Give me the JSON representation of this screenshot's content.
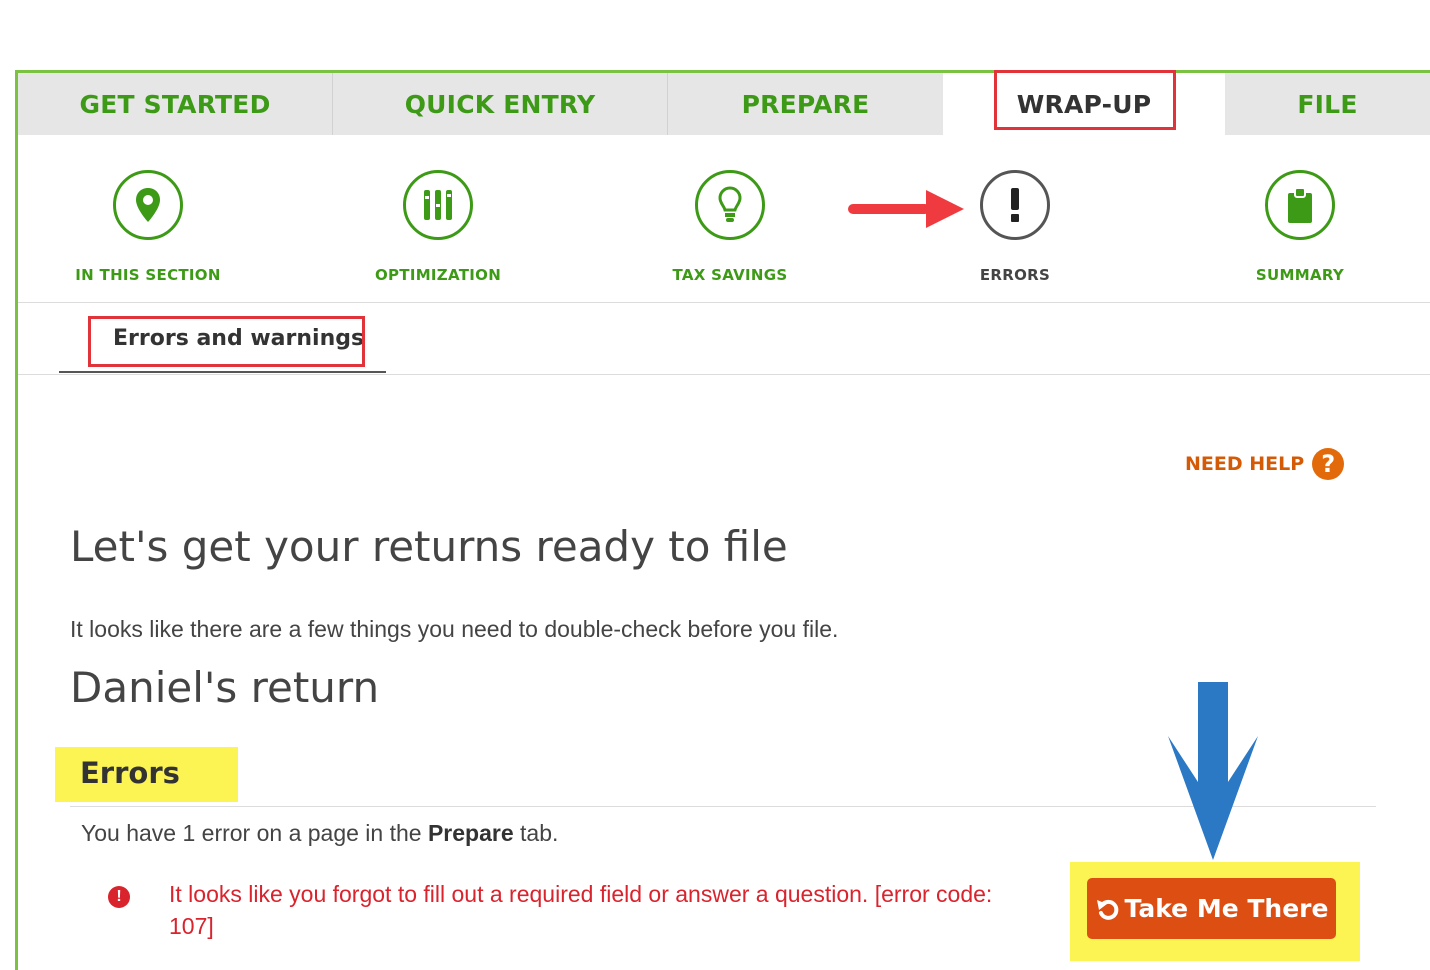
{
  "tabs": [
    {
      "label": "GET STARTED"
    },
    {
      "label": "QUICK ENTRY"
    },
    {
      "label": "PREPARE"
    },
    {
      "label": "WRAP-UP"
    },
    {
      "label": "FILE"
    }
  ],
  "section_nav": [
    {
      "label": "IN THIS SECTION",
      "icon": "location-pin-icon"
    },
    {
      "label": "OPTIMIZATION",
      "icon": "sliders-icon"
    },
    {
      "label": "TAX SAVINGS",
      "icon": "lightbulb-icon"
    },
    {
      "label": "ERRORS",
      "icon": "exclamation-icon"
    },
    {
      "label": "SUMMARY",
      "icon": "clipboard-icon"
    }
  ],
  "subtab": {
    "label": "Errors and warnings"
  },
  "help": {
    "label": "NEED HELP",
    "icon": "question-icon"
  },
  "main": {
    "title": "Let's get your returns ready to file",
    "intro": "It looks like there are a few things you need to double-check before you file.",
    "return_title": "Daniel's return"
  },
  "errors": {
    "heading": "Errors",
    "count_prefix": "You have 1 error on a page in the ",
    "count_tab": "Prepare",
    "count_suffix": " tab.",
    "message": "It looks like you forgot to fill out a required field or answer a question. [error code: 107]",
    "button_label": "Take Me There",
    "button_icon": "undo-arrow-icon"
  },
  "colors": {
    "brand_green": "#3d9a16",
    "accent_orange": "#dd4e13",
    "error_red": "#d9232d",
    "highlight_yellow": "#fbf453"
  }
}
